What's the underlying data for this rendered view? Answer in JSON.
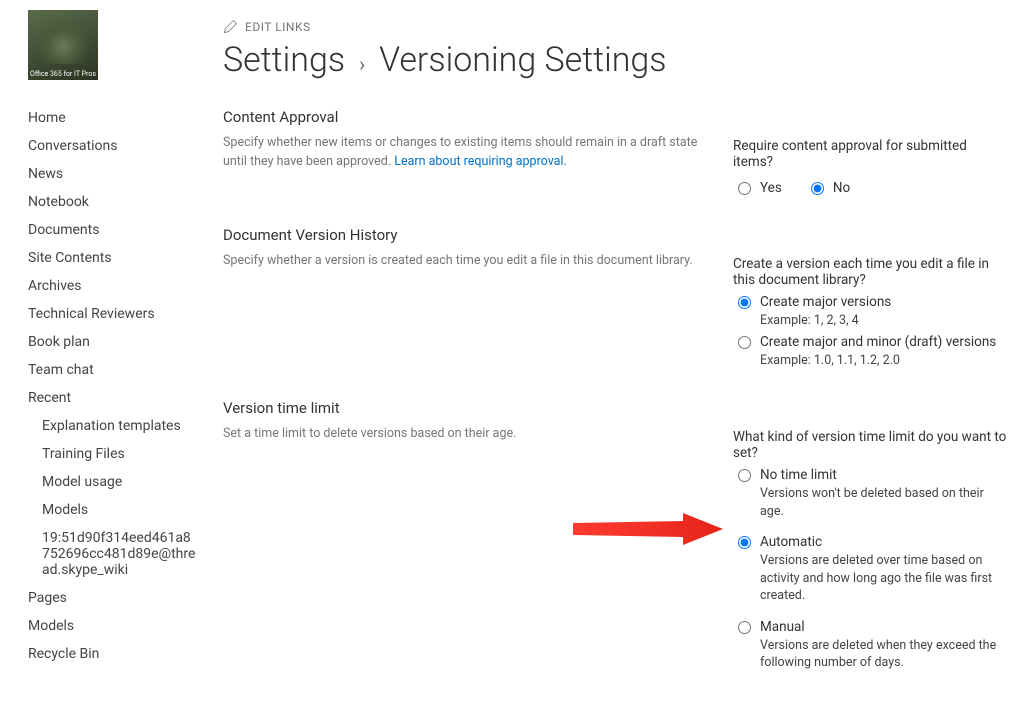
{
  "logo_caption": "Office 365 for IT Pros",
  "edit_links": "EDIT LINKS",
  "breadcrumb": {
    "root": "Settings",
    "current": "Versioning Settings"
  },
  "nav": [
    "Home",
    "Conversations",
    "News",
    "Notebook",
    "Documents",
    "Site Contents",
    "Archives",
    "Technical Reviewers",
    "Book plan",
    "Team chat",
    "Recent"
  ],
  "nav_recent": [
    "Explanation templates",
    "Training Files",
    "Model usage",
    "Models",
    "19:51d90f314eed461a8752696cc481d89e@thread.skype_wiki"
  ],
  "nav_tail": [
    "Pages",
    "Models",
    "Recycle Bin"
  ],
  "sections": {
    "approval": {
      "title": "Content Approval",
      "desc_a": "Specify whether new items or changes to existing items should remain in a draft state until they have been approved.  ",
      "desc_link": "Learn about requiring approval.",
      "field": "Require content approval for submitted items?",
      "yes": "Yes",
      "no": "No"
    },
    "history": {
      "title": "Document Version History",
      "desc": "Specify whether a version is created each time you edit a file in this document library.",
      "field": "Create a version each time you edit a file in this document library?",
      "opt1": "Create major versions",
      "opt1_sub": "Example: 1, 2, 3, 4",
      "opt2": "Create major and minor (draft) versions",
      "opt2_sub": "Example: 1.0, 1.1, 1.2, 2.0"
    },
    "timelimit": {
      "title": "Version time limit",
      "desc": "Set a time limit to delete versions based on their age.",
      "field": "What kind of version time limit do you want to set?",
      "opt1": "No time limit",
      "opt1_sub": "Versions won't be deleted based on their age.",
      "opt2": "Automatic",
      "opt2_sub": "Versions are deleted over time based on activity and how long ago the file was first created.",
      "opt3": "Manual",
      "opt3_sub": "Versions are deleted when they exceed the following number of days."
    }
  }
}
